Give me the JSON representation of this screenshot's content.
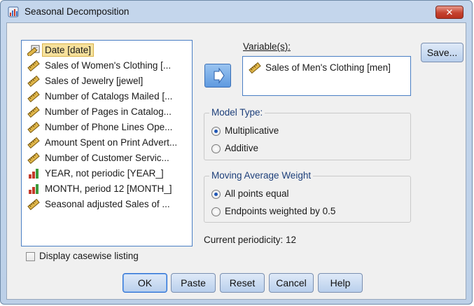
{
  "window": {
    "title": "Seasonal Decomposition",
    "close_label": "✕"
  },
  "source_list": {
    "items": [
      {
        "label": "Date [date]",
        "icon": "date-ruler-icon",
        "selected": true
      },
      {
        "label": "Sales of Women's Clothing [...",
        "icon": "scale-ruler-icon"
      },
      {
        "label": "Sales of Jewelry [jewel]",
        "icon": "scale-ruler-icon"
      },
      {
        "label": "Number of Catalogs Mailed [...",
        "icon": "scale-ruler-icon"
      },
      {
        "label": "Number of Pages in Catalog...",
        "icon": "scale-ruler-icon"
      },
      {
        "label": "Number of Phone Lines Ope...",
        "icon": "scale-ruler-icon"
      },
      {
        "label": "Amount Spent on Print Advert...",
        "icon": "scale-ruler-icon"
      },
      {
        "label": "Number of Customer Servic...",
        "icon": "scale-ruler-icon"
      },
      {
        "label": "YEAR, not periodic [YEAR_]",
        "icon": "ordinal-bars-icon"
      },
      {
        "label": "MONTH, period 12 [MONTH_]",
        "icon": "ordinal-bars-icon"
      },
      {
        "label": "Seasonal adjusted Sales of ...",
        "icon": "scale-ruler-icon"
      }
    ]
  },
  "display_casewise": {
    "label": "Display casewise listing",
    "checked": false
  },
  "variables": {
    "label": "Variable(s):",
    "items": [
      {
        "label": "Sales of Men's Clothing [men]",
        "icon": "scale-ruler-icon"
      }
    ]
  },
  "model_type": {
    "title": "Model Type:",
    "options": [
      {
        "label": "Multiplicative",
        "selected": true
      },
      {
        "label": "Additive",
        "selected": false
      }
    ]
  },
  "moving_average": {
    "title": "Moving Average Weight",
    "options": [
      {
        "label": "All points equal",
        "selected": true
      },
      {
        "label": "Endpoints weighted by 0.5",
        "selected": false
      }
    ]
  },
  "periodicity": "Current periodicity: 12",
  "buttons": {
    "save": "Save...",
    "ok": "OK",
    "paste": "Paste",
    "reset": "Reset",
    "cancel": "Cancel",
    "help": "Help"
  },
  "colors": {
    "accent": "#4a7fc4",
    "selection": "#f7e19c",
    "close": "#c5422f"
  }
}
